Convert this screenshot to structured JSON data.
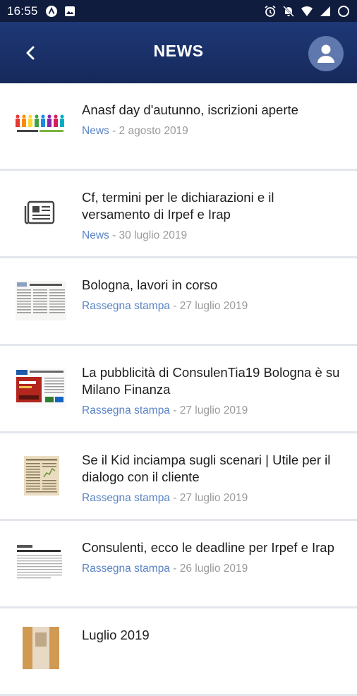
{
  "status": {
    "time": "16:55",
    "left_icons": [
      "app-notification-icon",
      "image-notification-icon"
    ],
    "right_icons": [
      "alarm-icon",
      "mute-icon",
      "wifi-icon",
      "signal-icon",
      "battery-icon"
    ]
  },
  "header": {
    "title": "NEWS",
    "back_icon": "chevron-left-icon",
    "profile_icon": "user-icon"
  },
  "colors": {
    "statusbar": "#0f1c3e",
    "header": "#1e3877",
    "avatar": "#5f78ad",
    "category": "#5a84c6",
    "date": "#9a9a9a",
    "divider": "#e3e6ec"
  },
  "news": [
    {
      "title": "Anasf day d'autunno, iscrizioni aperte",
      "category": "News",
      "separator": " - ",
      "date": "2 agosto 2019",
      "thumb": "colorful-figures-banner"
    },
    {
      "title": "Cf, termini per le dichiarazioni e il versamento di Irpef e Irap",
      "category": "News",
      "separator": " - ",
      "date": "30 luglio 2019",
      "thumb": "newspaper-icon"
    },
    {
      "title": "Bologna, lavori in corso",
      "category": "Rassegna stampa",
      "separator": " - ",
      "date": "27 luglio 2019",
      "thumb": "newspaper-clipping"
    },
    {
      "title": "La pubblicità di ConsulenTia19 Bologna è su Milano Finanza",
      "category": "Rassegna stampa",
      "separator": " - ",
      "date": "27 luglio 2019",
      "thumb": "magazine-ad-clipping"
    },
    {
      "title": "Se il Kid inciampa sugli scenari | Utile per il dialogo con il cliente",
      "category": "Rassegna stampa",
      "separator": " - ",
      "date": "27 luglio 2019",
      "thumb": "old-newspaper-clipping"
    },
    {
      "title": "Consulenti, ecco le deadline per Irpef e Irap",
      "category": "Rassegna stampa",
      "separator": " - ",
      "date": "26 luglio 2019",
      "thumb": "article-clipping"
    },
    {
      "title": "Luglio 2019",
      "category": "",
      "separator": "",
      "date": "",
      "thumb": "photo-thumbnail"
    }
  ]
}
